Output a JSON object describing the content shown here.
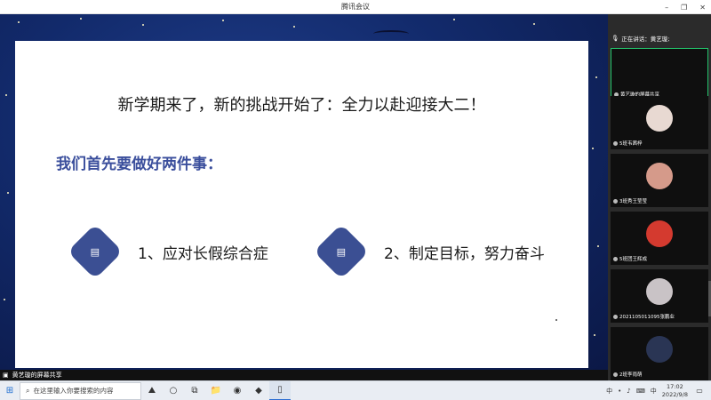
{
  "window": {
    "title": "腾讯会议",
    "controls": [
      "–",
      "❐",
      "✕"
    ]
  },
  "slide": {
    "title": "新学期来了，新的挑战开始了：全力以赴迎接大二！",
    "subtitle": "我们首先要做好两件事：",
    "items": [
      {
        "label": "1、应对长假综合症",
        "icon": "document-icon"
      },
      {
        "label": "2、制定目标，努力奋斗",
        "icon": "document-icon"
      }
    ]
  },
  "share_caption": {
    "label": "黄艺璇的屏幕共享"
  },
  "panel": {
    "speaking": "正在讲话：黄艺璇;",
    "participants": [
      {
        "name": "黄艺璇的屏幕共享",
        "avatar_color": "#0f0f0f",
        "active": true
      },
      {
        "name": "5班韦茜梓",
        "avatar_color": "#e8d9d2"
      },
      {
        "name": "3班秀王莹莹",
        "avatar_color": "#d59a8a"
      },
      {
        "name": "5班团王辉成",
        "avatar_color": "#d43a2f"
      },
      {
        "name": "2021105011095张鹏业",
        "avatar_color": "#c9c3c6"
      },
      {
        "name": "2班李雨萌",
        "avatar_color": "#2a3554"
      }
    ]
  },
  "taskbar": {
    "search_placeholder": "在这里输入你要搜索的内容",
    "tray_items": [
      "中",
      "•",
      "♪",
      "⌨"
    ],
    "time": "17:02",
    "date": "2022/9/8",
    "ime": "中"
  }
}
